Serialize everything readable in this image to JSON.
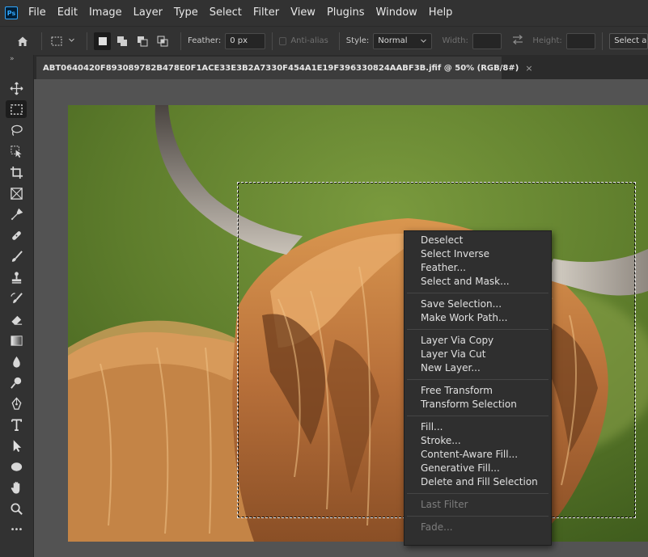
{
  "app": {
    "logo_text": "Ps"
  },
  "menubar": {
    "items": [
      "File",
      "Edit",
      "Image",
      "Layer",
      "Type",
      "Select",
      "Filter",
      "View",
      "Plugins",
      "Window",
      "Help"
    ]
  },
  "options": {
    "feather_label": "Feather:",
    "feather_value": "0 px",
    "antialias_label": "Anti-alias",
    "style_label": "Style:",
    "style_value": "Normal",
    "width_label": "Width:",
    "height_label": "Height:",
    "select_subject_label": "Select a"
  },
  "document": {
    "tab_title": "ABT0640420F893089782B478E0F1ACE33E3B2A7330F454A1E19F396330824AABF3B.jfif @ 50% (RGB/8#)",
    "close_glyph": "×"
  },
  "toolbar": {
    "collapse_glyph": "»",
    "more_glyph": "•••"
  },
  "context_menu": {
    "group1": [
      "Deselect",
      "Select Inverse",
      "Feather...",
      "Select and Mask..."
    ],
    "group2": [
      "Save Selection...",
      "Make Work Path..."
    ],
    "group3": [
      "Layer Via Copy",
      "Layer Via Cut",
      "New Layer..."
    ],
    "group4": [
      "Free Transform",
      "Transform Selection"
    ],
    "group5": [
      "Fill...",
      "Stroke...",
      "Content-Aware Fill...",
      "Generative Fill...",
      "Delete and Fill Selection"
    ],
    "group6_disabled": [
      "Last Filter"
    ],
    "group7_disabled": [
      "Fade..."
    ]
  },
  "colors": {
    "ui_bg": "#323232",
    "canvas_bg": "#535353",
    "menu_bg": "#2f2f2f",
    "accent": "#31a8ff"
  }
}
